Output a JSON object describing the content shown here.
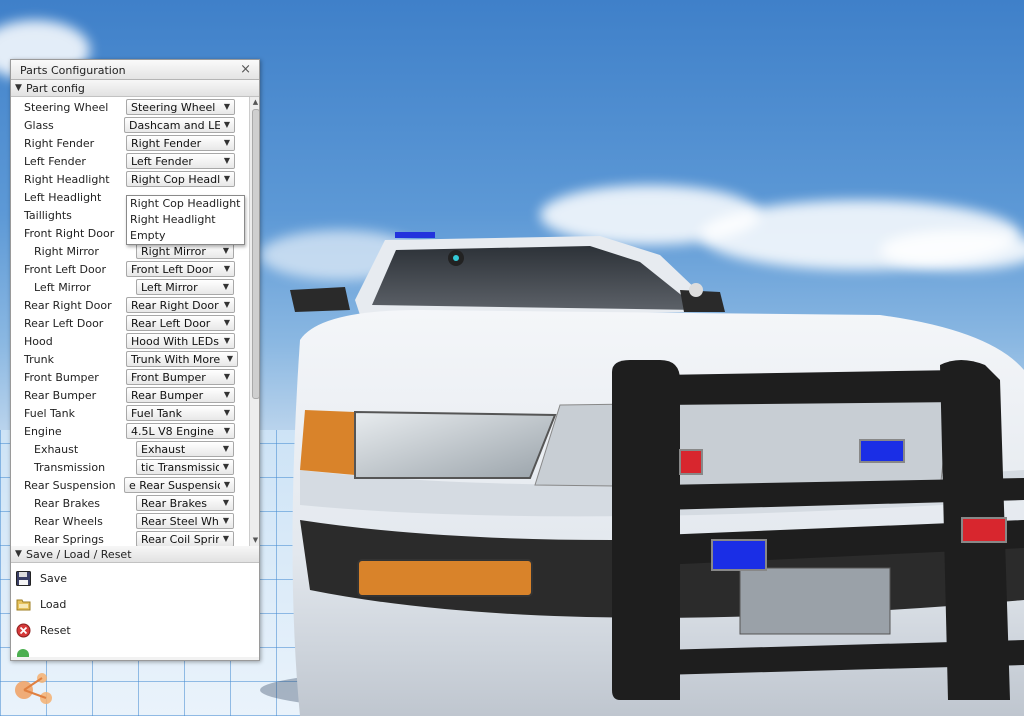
{
  "panel": {
    "title": "Parts Configuration",
    "close_glyph": "×",
    "part_section": "Part config",
    "save_section": "Save / Load / Reset"
  },
  "parts": [
    {
      "label": "Steering Wheel",
      "value": "Steering Wheel"
    },
    {
      "label": "Glass",
      "value": "Dashcam and LEDs"
    },
    {
      "label": "Right Fender",
      "value": "Right Fender"
    },
    {
      "label": "Left Fender",
      "value": "Left Fender"
    },
    {
      "label": "Right Headlight",
      "value": "Right Cop Headlight"
    },
    {
      "label": "Left Headlight",
      "value": ""
    },
    {
      "label": "Taillights",
      "value": ""
    },
    {
      "label": "Front Right Door",
      "value": ""
    },
    {
      "label": "Right Mirror",
      "value": "Right Mirror"
    },
    {
      "label": "Front Left Door",
      "value": "Front Left Door"
    },
    {
      "label": "Left Mirror",
      "value": "Left Mirror"
    },
    {
      "label": "Rear Right Door",
      "value": "Rear Right Door"
    },
    {
      "label": "Rear Left Door",
      "value": "Rear Left Door"
    },
    {
      "label": "Hood",
      "value": "Hood With LEDs"
    },
    {
      "label": "Trunk",
      "value": "Trunk With More LEDs"
    },
    {
      "label": "Front Bumper",
      "value": "Front Bumper"
    },
    {
      "label": "Rear Bumper",
      "value": "Rear Bumper"
    },
    {
      "label": "Fuel Tank",
      "value": "Fuel Tank"
    },
    {
      "label": "Engine",
      "value": "4.5L V8 Engine"
    },
    {
      "label": "Exhaust",
      "value": "Exhaust"
    },
    {
      "label": "Transmission",
      "value": "tic Transmission"
    },
    {
      "label": "Rear Suspension",
      "value": "e Rear Suspension"
    },
    {
      "label": "Rear Brakes",
      "value": "Rear Brakes"
    },
    {
      "label": "Rear Wheels",
      "value": "Rear Steel Wheels"
    },
    {
      "label": "Rear Springs",
      "value": "Rear Coil Springs"
    }
  ],
  "dropdown_options": [
    "Right Cop Headlight",
    "Right Headlight",
    "Empty"
  ],
  "actions": [
    {
      "label": "Save",
      "icon": "floppy-disk-icon"
    },
    {
      "label": "Load",
      "icon": "folder-icon"
    },
    {
      "label": "Reset",
      "icon": "reset-red-x-icon"
    }
  ],
  "colors": {
    "panel_bg": "#f2f2f2",
    "sky_top": "#3f80c9",
    "car_body": "#e9edf2",
    "push_bar": "#1e1e1e",
    "led_blue": "#1a2ee6",
    "led_red": "#d8262e",
    "turn_signal": "#d9832a"
  }
}
